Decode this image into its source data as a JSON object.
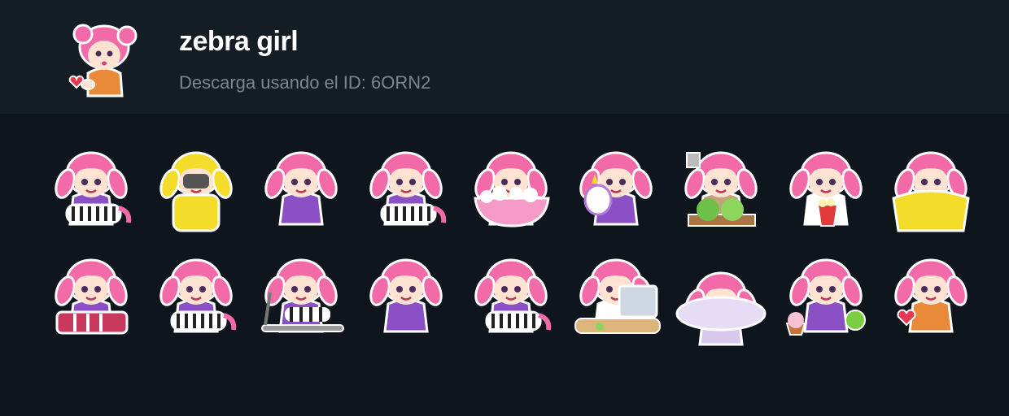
{
  "pack": {
    "title": "zebra girl",
    "subtitle": "Descarga usando el ID: 6ORN2",
    "thumbnail_icon": "zebra-girl-heart-sticker-icon"
  },
  "colors": {
    "background": "#0e151c",
    "header": "#141c24",
    "hair": "#f26aa8",
    "shirt": "#8b4fc6"
  },
  "stickers": [
    {
      "icon": "zebra-girl-blushing-sticker",
      "prop": "zebra",
      "shirt": "#8b4fc6",
      "hair": "#f06aa6"
    },
    {
      "icon": "hazmat-suit-girl-sticker",
      "prop": "hazmat",
      "shirt": "#f3dc2a",
      "hair": "#f3dc2a"
    },
    {
      "icon": "winking-girl-sticker",
      "prop": "wink",
      "shirt": "#8b4fc6",
      "hair": "#f26aa8"
    },
    {
      "icon": "laughing-zebra-girl-sticker",
      "prop": "zebra",
      "shirt": "#8b4fc6",
      "hair": "#f26aa8"
    },
    {
      "icon": "bathtub-girl-sticker",
      "prop": "bath",
      "shirt": "#ffffff",
      "hair": "#f26aa8"
    },
    {
      "icon": "unicorn-hug-girl-sticker",
      "prop": "unicorn",
      "shirt": "#8b4fc6",
      "hair": "#f26aa8"
    },
    {
      "icon": "cleaver-cabbage-girl-sticker",
      "prop": "cabbage",
      "shirt": "#c6a27a",
      "hair": "#f26aa8"
    },
    {
      "icon": "crying-popcorn-girl-sticker",
      "prop": "popcorn",
      "shirt": "#ffffff",
      "hair": "#f26aa8"
    },
    {
      "icon": "shocked-yellow-hoodie-girl-sticker",
      "prop": "hoodie",
      "shirt": "#f3dc2a",
      "hair": "#f26aa8"
    },
    {
      "icon": "suitcase-zebra-girl-sticker",
      "prop": "suitcase",
      "shirt": "#8b4fc6",
      "hair": "#f26aa8"
    },
    {
      "icon": "heart-eyes-zebra-girl-sticker",
      "prop": "zebra",
      "shirt": "#8b4fc6",
      "hair": "#f26aa8"
    },
    {
      "icon": "treadmill-zebra-girl-sticker",
      "prop": "treadmill",
      "shirt": "#8b4fc6",
      "hair": "#f26aa8"
    },
    {
      "icon": "nervous-girl-sticker",
      "prop": "nervous",
      "shirt": "#8b4fc6",
      "hair": "#f26aa8"
    },
    {
      "icon": "grumpy-zebra-girl-sticker",
      "prop": "zebra",
      "shirt": "#8b4fc6",
      "hair": "#f26aa8"
    },
    {
      "icon": "computer-desk-girl-sticker",
      "prop": "desk",
      "shirt": "#ffffff",
      "hair": "#f26aa8"
    },
    {
      "icon": "sleeping-girl-sticker",
      "prop": "sleep",
      "shirt": "#d8c8ee",
      "hair": "#f26aa8"
    },
    {
      "icon": "cupcake-apple-girl-sticker",
      "prop": "apple",
      "shirt": "#8b4fc6",
      "hair": "#f26aa8"
    },
    {
      "icon": "blowing-heart-girl-sticker",
      "prop": "heart",
      "shirt": "#e88a3a",
      "hair": "#f26aa8"
    }
  ]
}
